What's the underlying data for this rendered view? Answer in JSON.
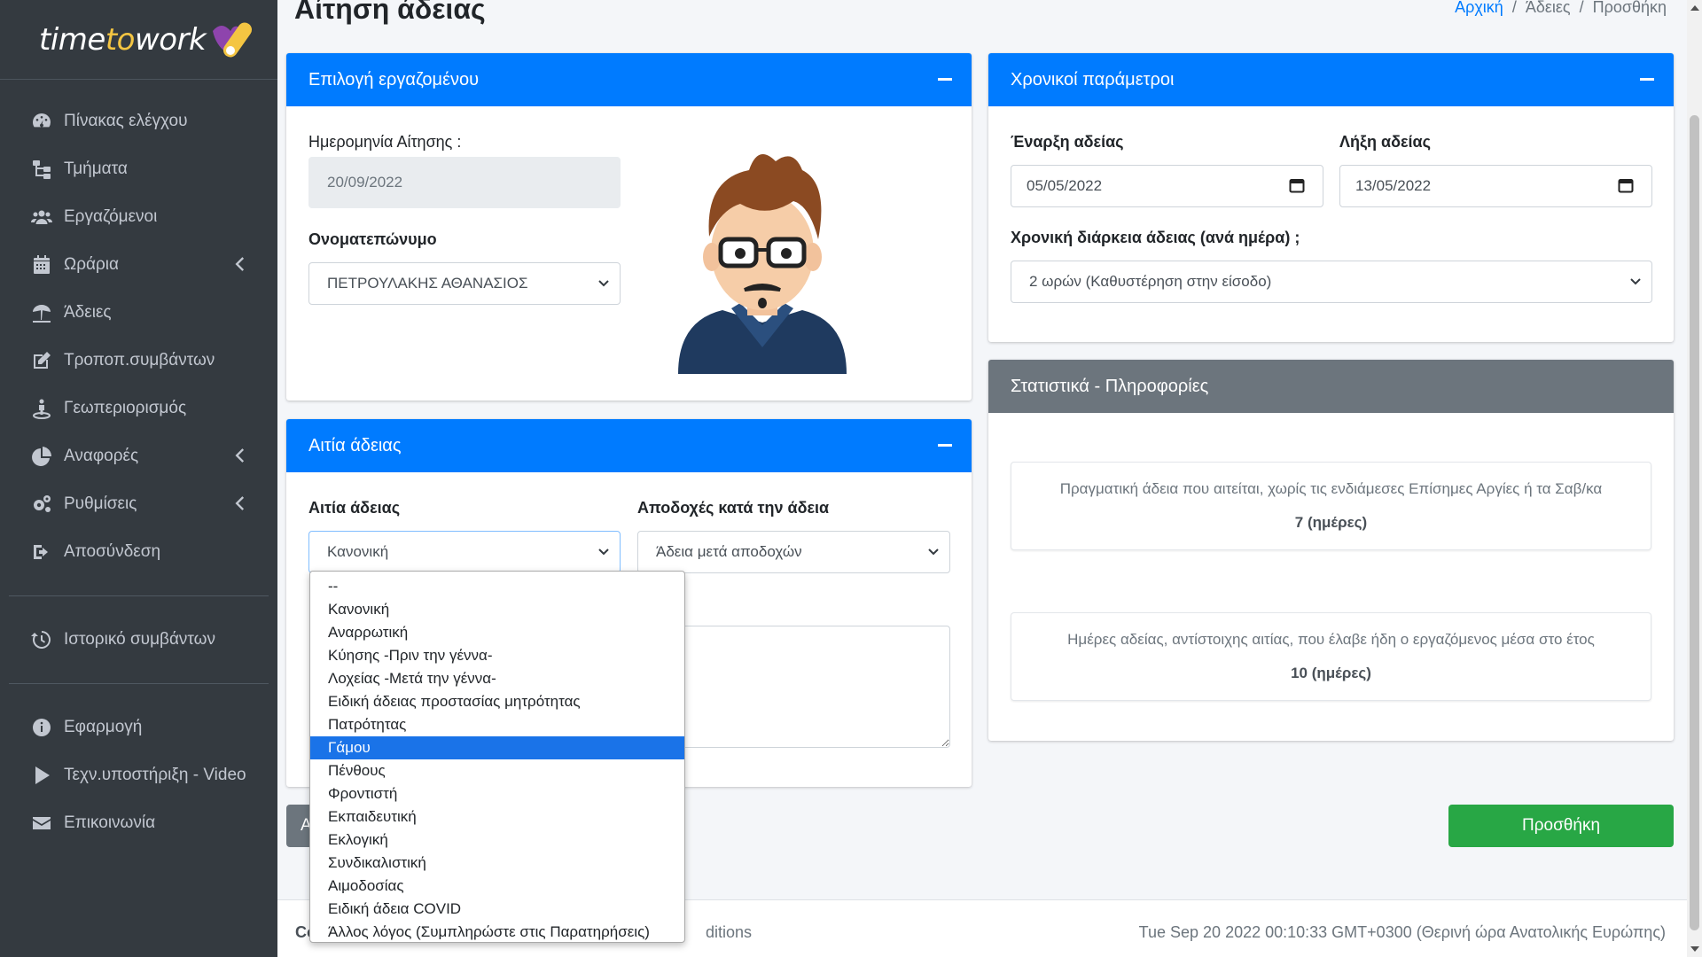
{
  "brand": {
    "part1": "time",
    "part2": "to",
    "part3": "work"
  },
  "header": {
    "title": "Αίτηση άδειας",
    "breadcrumb": [
      "Αρχική",
      "Άδειες",
      "Προσθήκη"
    ]
  },
  "sidebar": {
    "items": [
      {
        "label": "Πίνακας ελέγχου",
        "icon": "dashboard-icon"
      },
      {
        "label": "Τμήματα",
        "icon": "sitemap-icon"
      },
      {
        "label": "Εργαζόμενοι",
        "icon": "users-icon"
      },
      {
        "label": "Ωράρια",
        "icon": "calendar-icon",
        "has_children": true
      },
      {
        "label": "Άδειες",
        "icon": "umbrella-beach-icon"
      },
      {
        "label": "Τροποπ.συμβάντων",
        "icon": "edit-icon"
      },
      {
        "label": "Γεωπεριορισμός",
        "icon": "street-view-icon"
      },
      {
        "label": "Αναφορές",
        "icon": "chart-pie-icon",
        "has_children": true
      },
      {
        "label": "Ρυθμίσεις",
        "icon": "cogs-icon",
        "has_children": true
      },
      {
        "label": "Αποσύνδεση",
        "icon": "sign-out-icon"
      }
    ],
    "history": {
      "label": "Ιστορικό συμβάντων",
      "icon": "history-icon"
    },
    "bottom": [
      {
        "label": "Εφαρμογή",
        "icon": "info-icon"
      },
      {
        "label": "Τεχν.υποστήριξη - Video",
        "icon": "play-icon"
      },
      {
        "label": "Επικοινωνία",
        "icon": "envelope-icon"
      }
    ]
  },
  "employee_card": {
    "title": "Επιλογή εργαζομένου",
    "date_label": "Ημερομηνία Αίτησης :",
    "date_value": "20/09/2022",
    "name_label": "Ονοματεπώνυμο",
    "name_value": "ΠΕΤΡΟΥΛΑΚΗΣ ΑΘΑΝΑΣΙΟΣ"
  },
  "reason_card": {
    "title": "Αιτία άδειας",
    "reason_label": "Αιτία άδειας",
    "reason_value": "Κανονική",
    "pay_label": "Αποδοχές κατά την άδεια",
    "pay_value": "Άδεια μετά αποδοχών",
    "reason_options": [
      "--",
      "Κανονική",
      "Αναρρωτική",
      "Κύησης -Πριν την γέννα-",
      "Λοχείας -Μετά την γέννα-",
      "Ειδική άδειας προστασίας μητρότητας",
      "Πατρότητας",
      "Γάμου",
      "Πένθους",
      "Φροντιστή",
      "Εκπαιδευτική",
      "Εκλογική",
      "Συνδικαλιστική",
      "Αιμοδοσίας",
      "Ειδική άδεια COVID",
      "Άλλος λόγος (Συμπληρώστε στις Παρατηρήσεις)"
    ],
    "highlighted_option": "Γάμου"
  },
  "time_card": {
    "title": "Χρονικοί παράμετροι",
    "start_label": "Έναρξη αδείας",
    "start_value": "05/05/2022",
    "end_label": "Λήξη αδείας",
    "end_value": "13/05/2022",
    "duration_label": "Χρονική διάρκεια άδειας (ανά ημέρα) ;",
    "duration_value": "2 ωρών (Καθυστέρηση στην είσοδο)"
  },
  "stats_card": {
    "title": "Στατιστικά - Πληροφορίες",
    "box1_text": "Πραγματική άδεια που αιτείται, χωρίς τις ενδιάμεσες Επίσημες Αργίες ή τα Σαβ/κα",
    "box1_value": "7 (ημέρες)",
    "box2_text": "Ημέρες αδείας, αντίστοιχης αιτίας, που έλαβε ήδη ο εργαζόμενος μέσα στο έτος",
    "box2_value": "10 (ημέρες)"
  },
  "actions": {
    "add_label": "Προσθήκη",
    "back_label": "A"
  },
  "footer": {
    "left": "Co",
    "mid": "ditions",
    "right": "Tue Sep 20 2022 00:10:33 GMT+0300 (Θερινή ώρα Ανατολικής Ευρώπης)"
  },
  "colors": {
    "primary": "#007bff",
    "success": "#28a745",
    "sidebar": "#343a40",
    "secondary": "#6c757d"
  }
}
